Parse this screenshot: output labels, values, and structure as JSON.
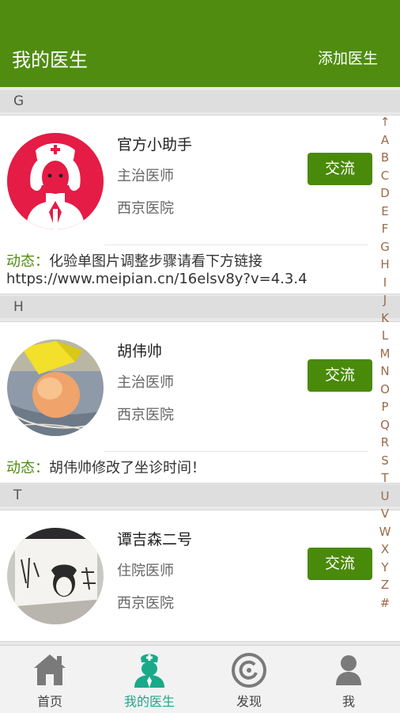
{
  "header": {
    "title": "我的医生",
    "add_label": "添加医生"
  },
  "colors": {
    "brand_green": "#4f8c0f",
    "tab_active": "#1aa98a"
  },
  "sections": [
    {
      "letter": "G",
      "doctor": {
        "name": "官方小助手",
        "title": "主治医师",
        "hospital": "西京医院",
        "avatar": "nurse-icon",
        "chat_label": "交流",
        "dynamic_label": "动态：",
        "dynamic_text": "化验单图片调整步骤请看下方链接",
        "dynamic_extra": "https://www.meipian.cn/16elsv8y?v=4.3.4"
      }
    },
    {
      "letter": "H",
      "doctor": {
        "name": "胡伟帅",
        "title": "主治医师",
        "hospital": "西京医院",
        "avatar": "peach-photo",
        "chat_label": "交流",
        "dynamic_label": "动态：",
        "dynamic_text": "胡伟帅修改了坐诊时间！"
      }
    },
    {
      "letter": "T",
      "doctor": {
        "name": "谭吉森二号",
        "title": "住院医师",
        "hospital": "西京医院",
        "avatar": "cup-photo",
        "chat_label": "交流"
      }
    }
  ],
  "index_letters": [
    "↑",
    "A",
    "B",
    "C",
    "D",
    "E",
    "F",
    "G",
    "H",
    "I",
    "J",
    "K",
    "L",
    "M",
    "N",
    "O",
    "P",
    "Q",
    "R",
    "S",
    "T",
    "U",
    "V",
    "W",
    "X",
    "Y",
    "Z",
    "#"
  ],
  "tabs": [
    {
      "label": "首页",
      "icon": "home-icon",
      "active": false
    },
    {
      "label": "我的医生",
      "icon": "doctor-icon",
      "active": true
    },
    {
      "label": "发现",
      "icon": "discover-icon",
      "active": false
    },
    {
      "label": "我",
      "icon": "user-icon",
      "active": false
    }
  ]
}
